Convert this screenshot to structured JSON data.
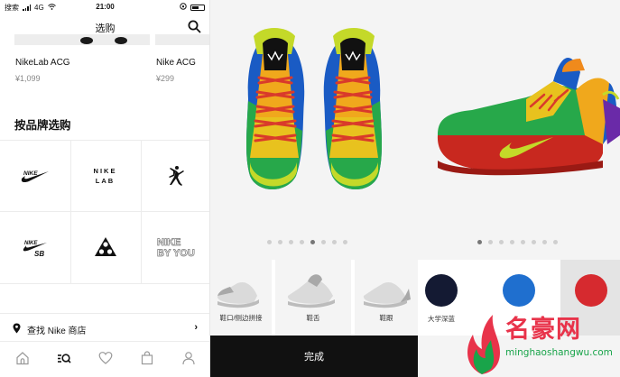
{
  "status_bar": {
    "carrier": "搜索",
    "network": "4G",
    "time": "21:00"
  },
  "nav": {
    "title": "选购"
  },
  "products": [
    {
      "name": "NikeLab ACG",
      "price": "¥1,099"
    },
    {
      "name": "Nike ACG",
      "price": "¥299"
    }
  ],
  "brands_section": {
    "title": "按品牌选购",
    "brands": [
      {
        "icon": "nike-swoosh-logo"
      },
      {
        "icon": "nikelab-logo",
        "text_line1": "NIKE",
        "text_line2": "LAB"
      },
      {
        "icon": "jordan-jumpman-logo"
      },
      {
        "icon": "nike-sb-logo",
        "text": "SB"
      },
      {
        "icon": "acg-logo"
      },
      {
        "icon": "nike-by-you-logo",
        "text_line1": "NIKE",
        "text_line2": "BY YOU"
      }
    ]
  },
  "find_store": {
    "label": "查找 Nike 商店"
  },
  "tabbar": {
    "items": [
      "home-icon",
      "shop-search-icon",
      "heart-icon",
      "bag-icon",
      "profile-icon"
    ],
    "active_index": 1
  },
  "builder": {
    "view_dots": {
      "count": 8,
      "active_index": 4
    },
    "side_dots": {
      "count": 8,
      "active_index": 0
    },
    "options": [
      {
        "label": "鞋口/侧边拼接"
      },
      {
        "label": "鞋舌"
      },
      {
        "label": "鞋跟"
      }
    ],
    "swatches": [
      {
        "label": "大学深蓝",
        "color": "#141a33"
      },
      {
        "label": "",
        "color": "#1f6fcf"
      },
      {
        "label": "",
        "color": "#d62a2f"
      }
    ],
    "done_label": "完成"
  },
  "watermark": {
    "text": "名豪网",
    "url": "minghaoshangwu.com"
  }
}
